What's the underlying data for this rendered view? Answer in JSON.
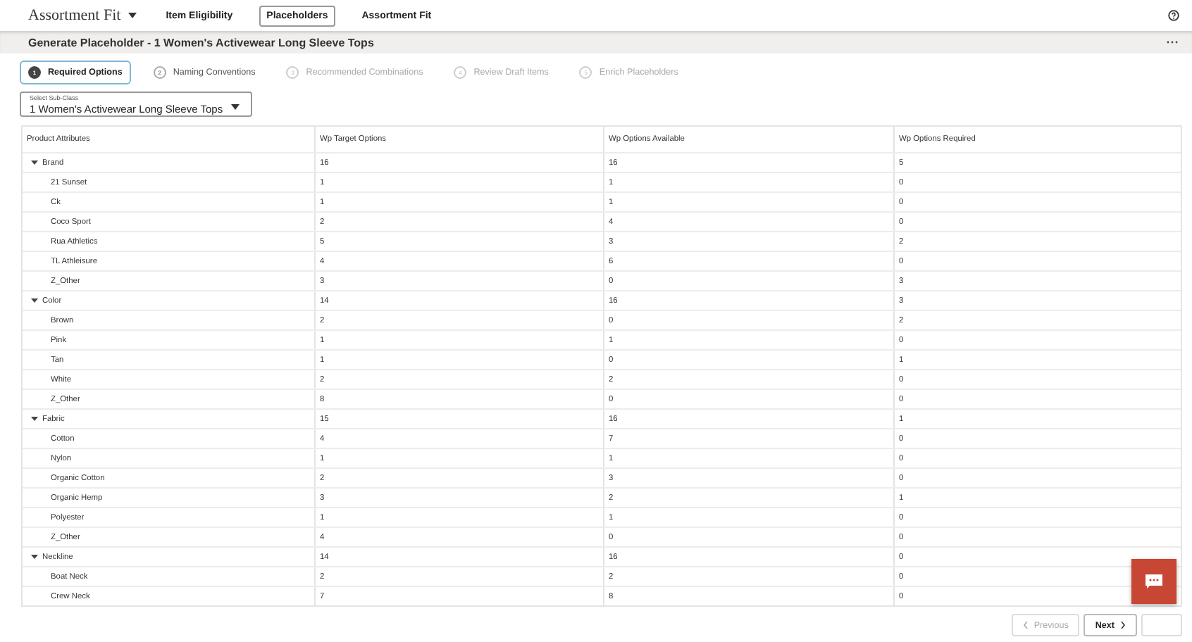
{
  "app": {
    "title": "Assortment Fit",
    "nav": [
      {
        "label": "Item Eligibility",
        "selected": false
      },
      {
        "label": "Placeholders",
        "selected": true
      },
      {
        "label": "Assortment Fit",
        "selected": false
      }
    ]
  },
  "page_title": "Generate Placeholder - 1 Women's Activewear Long Sleeve Tops",
  "steps": [
    {
      "number": "1",
      "label": "Required Options",
      "selected": true,
      "disabled": false
    },
    {
      "number": "2",
      "label": "Naming Conventions",
      "selected": false,
      "disabled": false
    },
    {
      "number": "3",
      "label": "Recommended Combinations",
      "selected": false,
      "disabled": true
    },
    {
      "number": "4",
      "label": "Review Draft Items",
      "selected": false,
      "disabled": true
    },
    {
      "number": "5",
      "label": "Enrich Placeholders",
      "selected": false,
      "disabled": true
    }
  ],
  "sub_class": {
    "label": "Select Sub-Class",
    "value": "1 Women's Activewear Long Sleeve Tops"
  },
  "table": {
    "columns": [
      "Product Attributes",
      "Wp Target Options",
      "Wp Options Available",
      "Wp Options Required"
    ],
    "rows": [
      {
        "name": "Brand",
        "values": [
          "16",
          "16",
          "5"
        ],
        "expanded": true,
        "children": [
          {
            "name": "21 Sunset",
            "values": [
              "1",
              "1",
              "0"
            ]
          },
          {
            "name": "Ck",
            "values": [
              "1",
              "1",
              "0"
            ]
          },
          {
            "name": "Coco Sport",
            "values": [
              "2",
              "4",
              "0"
            ]
          },
          {
            "name": "Rua Athletics",
            "values": [
              "5",
              "3",
              "2"
            ]
          },
          {
            "name": "TL Athleisure",
            "values": [
              "4",
              "6",
              "0"
            ]
          },
          {
            "name": "Z_Other",
            "values": [
              "3",
              "0",
              "3"
            ]
          }
        ]
      },
      {
        "name": "Color",
        "values": [
          "14",
          "16",
          "3"
        ],
        "expanded": true,
        "children": [
          {
            "name": "Brown",
            "values": [
              "2",
              "0",
              "2"
            ]
          },
          {
            "name": "Pink",
            "values": [
              "1",
              "1",
              "0"
            ]
          },
          {
            "name": "Tan",
            "values": [
              "1",
              "0",
              "1"
            ]
          },
          {
            "name": "White",
            "values": [
              "2",
              "2",
              "0"
            ]
          },
          {
            "name": "Z_Other",
            "values": [
              "8",
              "0",
              "0"
            ]
          }
        ]
      },
      {
        "name": "Fabric",
        "values": [
          "15",
          "16",
          "1"
        ],
        "expanded": true,
        "children": [
          {
            "name": "Cotton",
            "values": [
              "4",
              "7",
              "0"
            ]
          },
          {
            "name": "Nylon",
            "values": [
              "1",
              "1",
              "0"
            ]
          },
          {
            "name": "Organic Cotton",
            "values": [
              "2",
              "3",
              "0"
            ]
          },
          {
            "name": "Organic Hemp",
            "values": [
              "3",
              "2",
              "1"
            ]
          },
          {
            "name": "Polyester",
            "values": [
              "1",
              "1",
              "0"
            ]
          },
          {
            "name": "Z_Other",
            "values": [
              "4",
              "0",
              "0"
            ]
          }
        ]
      },
      {
        "name": "Neckline",
        "values": [
          "14",
          "16",
          "0"
        ],
        "expanded": true,
        "children": [
          {
            "name": "Boat Neck",
            "values": [
              "2",
              "2",
              "0"
            ]
          },
          {
            "name": "Crew Neck",
            "values": [
              "7",
              "8",
              "0"
            ]
          }
        ]
      }
    ]
  },
  "footer": [
    {
      "kind": "previous",
      "label": "Previous",
      "disabled": true
    },
    {
      "kind": "next",
      "label": "Next",
      "disabled": false
    },
    {
      "kind": "finish",
      "disabled": true
    }
  ]
}
